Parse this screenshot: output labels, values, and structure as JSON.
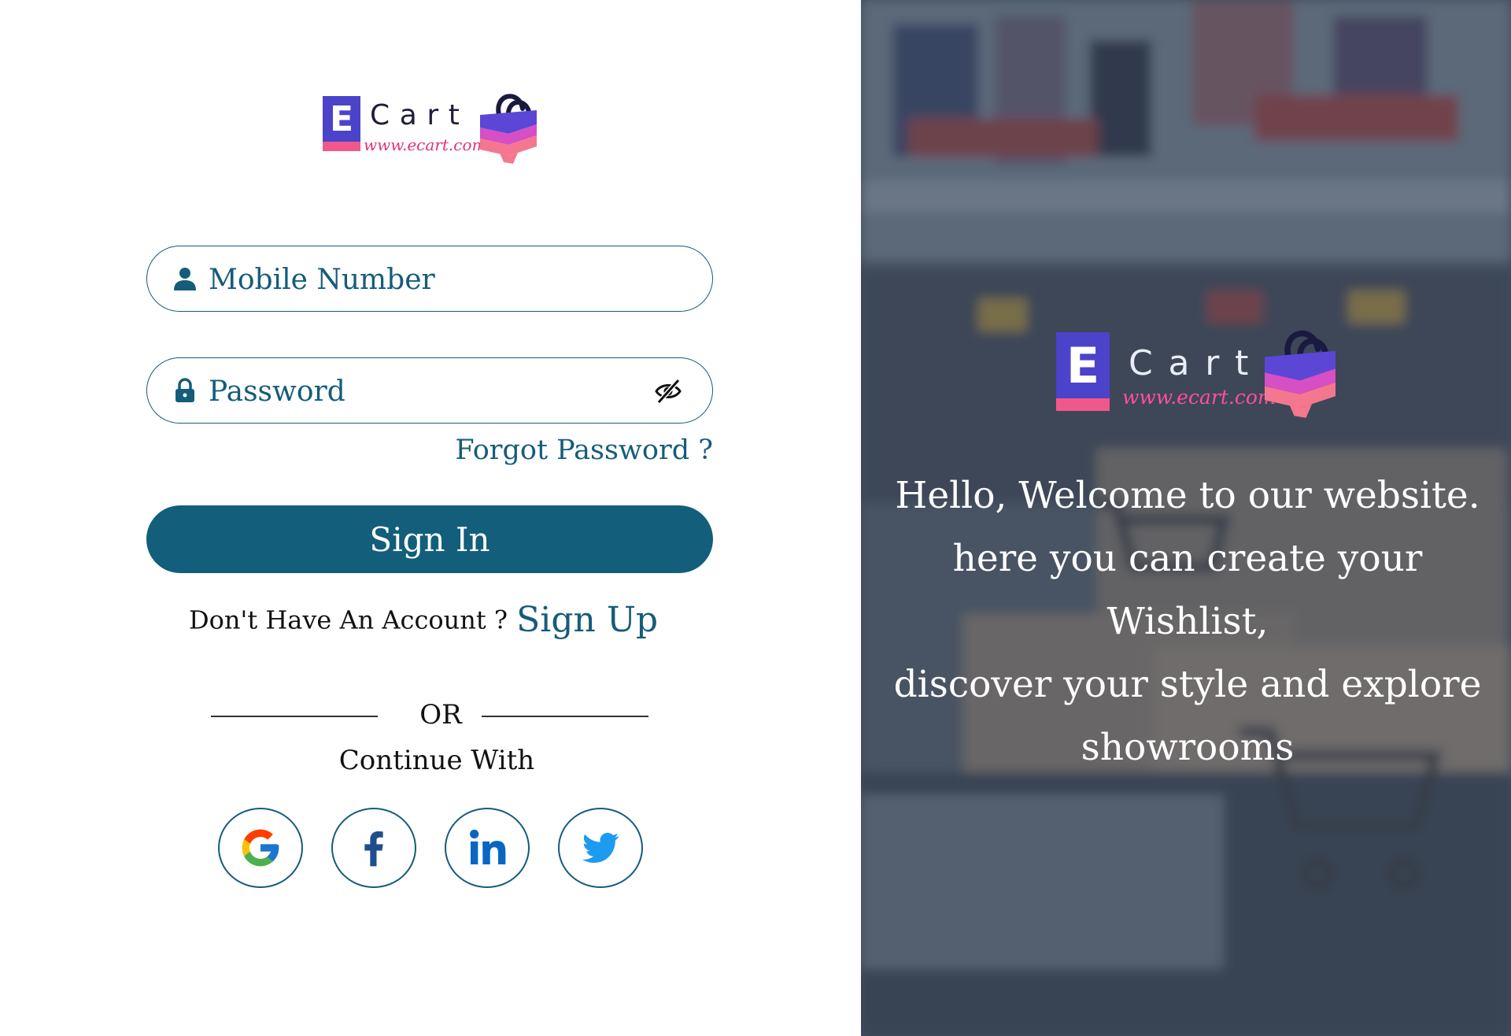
{
  "brand": {
    "letter": "E",
    "name": "Cart",
    "url": "www.ecart.com",
    "colors": {
      "purple": "#4b43c9",
      "pink": "#f0588c",
      "bag_purple": "#5b46d6",
      "bag_pink": "#f4778f"
    }
  },
  "login": {
    "mobile": {
      "placeholder": "Mobile Number",
      "icon": "user-icon"
    },
    "password": {
      "placeholder": "Password",
      "icon": "lock-icon",
      "toggle_icon": "eye-slash-icon"
    },
    "forgot_label": "Forgot Password ?",
    "signin_label": "Sign In",
    "no_account_text": "Don't Have An Account ?",
    "signup_label": "Sign Up",
    "or_text": "OR",
    "continue_text": "Continue With",
    "social": [
      {
        "name": "google",
        "icon": "google-icon"
      },
      {
        "name": "facebook",
        "icon": "facebook-icon"
      },
      {
        "name": "linkedin",
        "icon": "linkedin-icon"
      },
      {
        "name": "twitter",
        "icon": "twitter-icon"
      }
    ],
    "colors": {
      "primary": "#125e7b",
      "text_link": "#155c7a"
    }
  },
  "hero": {
    "welcome_lines": [
      "Hello, Welcome to our website.",
      "here you can create your Wishlist,",
      "discover your style and explore",
      "showrooms"
    ],
    "background_description": "blurred-shop-with-cart-boxes",
    "overlay_color": "#344256"
  }
}
